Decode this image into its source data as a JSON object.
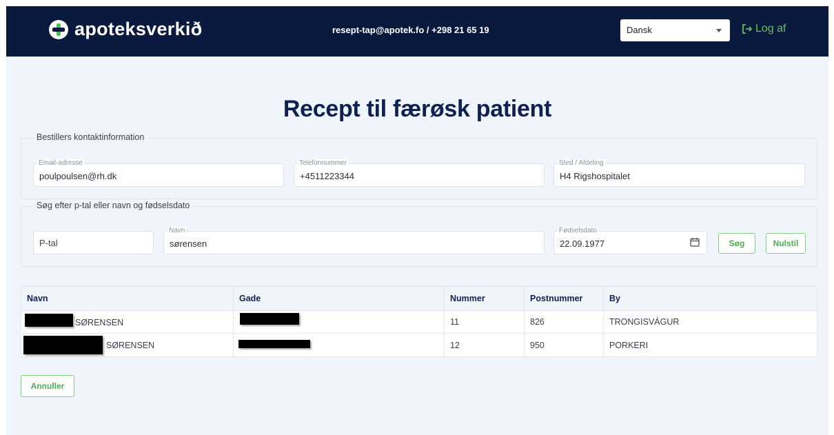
{
  "header": {
    "brand": "apoteksverkið",
    "contact": "resept-tap@apotek.fo / +298 21 65 19",
    "language": "Dansk",
    "logout_label": "Log af"
  },
  "page_title": "Recept til færøsk patient",
  "orderer": {
    "legend": "Bestillers kontaktinformation",
    "email_label": "Email-adresse",
    "email_value": "poulpoulsen@rh.dk",
    "phone_label": "Telefonnummer",
    "phone_value": "+4511223344",
    "dept_label": "Sted / Afdeling",
    "dept_value": "H4 Rigshospitalet"
  },
  "search": {
    "legend": "Søg efter p-tal eller navn og fødselsdato",
    "ptal_placeholder": "P-tal",
    "name_label": "Navn",
    "name_value": "sørensen",
    "dob_label": "Fødselsdato",
    "dob_value": "22.09.1977",
    "search_button": "Søg",
    "reset_button": "Nulstil"
  },
  "results": {
    "columns": [
      "Navn",
      "Gade",
      "Nummer",
      "Postnummer",
      "By"
    ],
    "rows": [
      {
        "name": "SØRENSEN",
        "street": "",
        "number": "11",
        "postal": "826",
        "city": "TRONGISVÁGUR"
      },
      {
        "name": "SØRENSEN",
        "street": "",
        "number": "12",
        "postal": "950",
        "city": "PORKERI"
      }
    ]
  },
  "cancel_button": "Annuller",
  "colors": {
    "navbar": "#0a1a3e",
    "accent_green": "#4caf50",
    "title_navy": "#0e2152",
    "page_bg": "#f0f5fb"
  }
}
